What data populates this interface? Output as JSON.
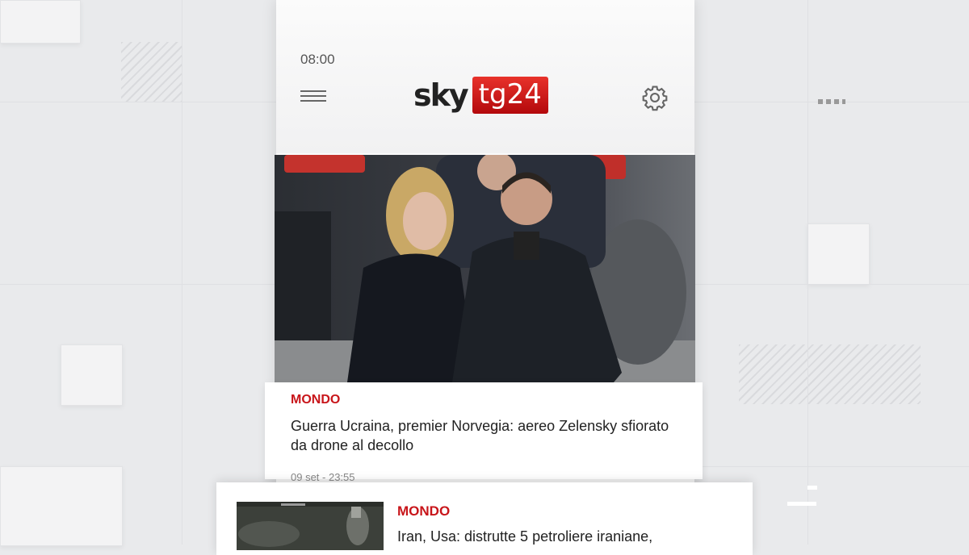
{
  "status": {
    "time": "08:00"
  },
  "header": {
    "logo_sky": "sky",
    "logo_tg": "tg24"
  },
  "article": {
    "category": "MONDO",
    "title": "Guerra Ucraina, premier Norvegia: aereo Zelensky sfiorato da drone al decollo",
    "date": "09 set - 23:55"
  },
  "next_article": {
    "category": "MONDO",
    "title": "Iran, Usa: distrutte 5 petroliere iraniane,"
  },
  "colors": {
    "brand_red": "#c8151a",
    "background": "#e9eaec"
  }
}
